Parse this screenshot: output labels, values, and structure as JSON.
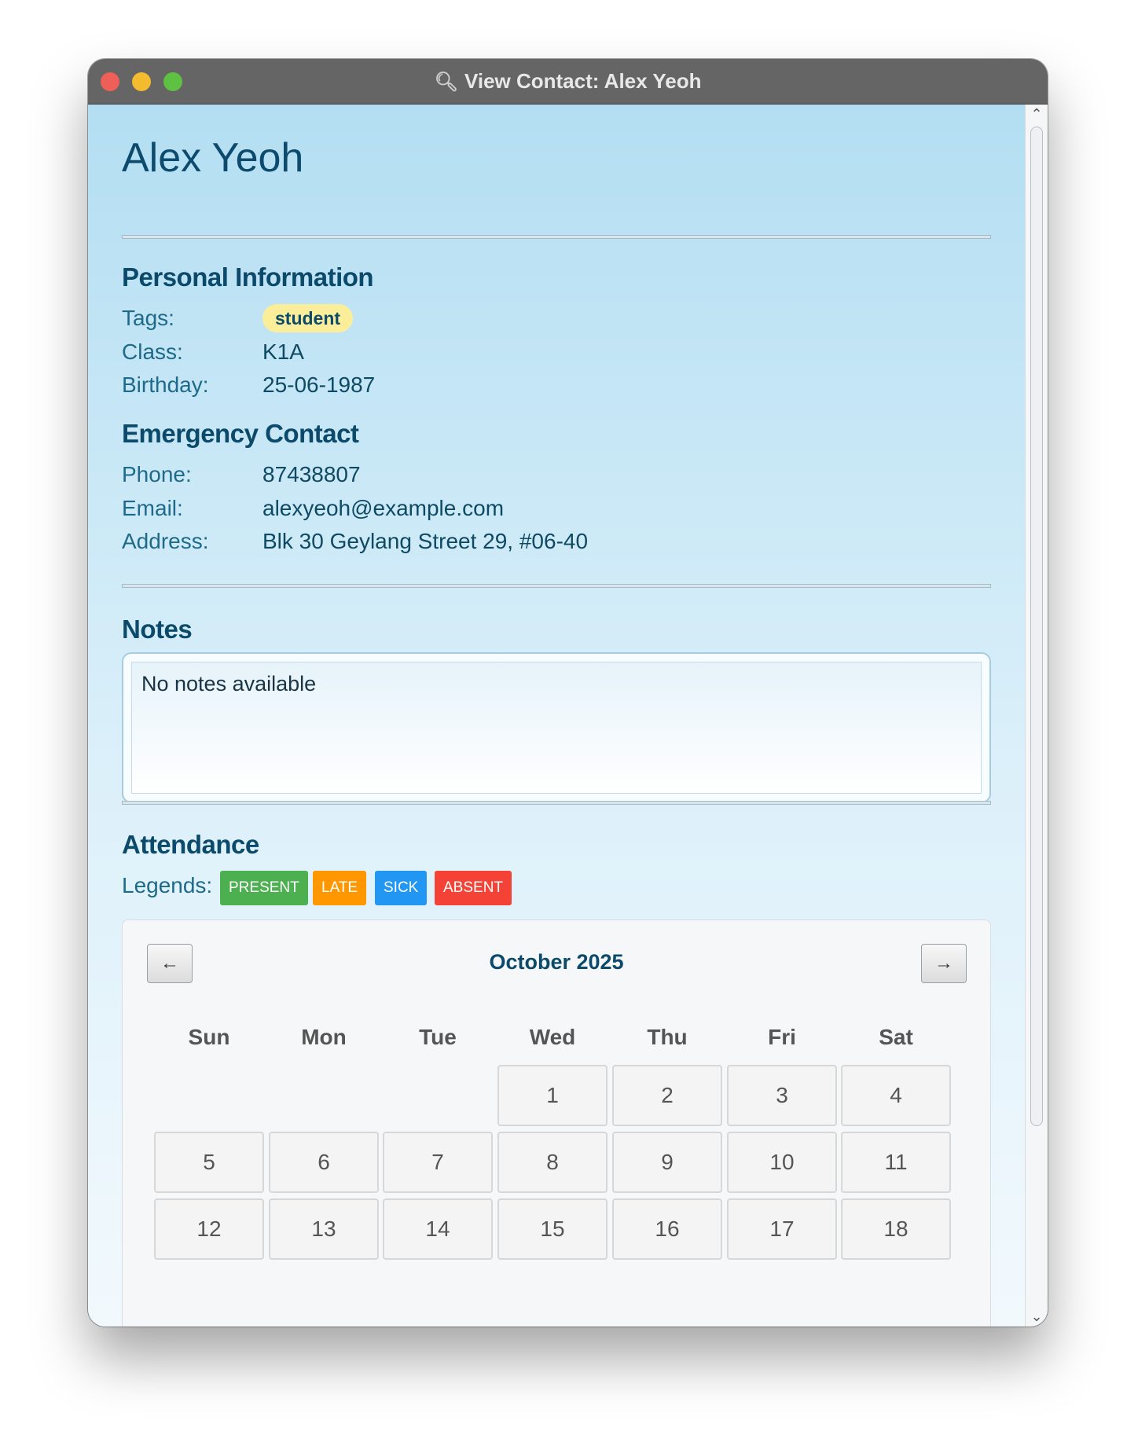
{
  "window": {
    "title": "View Contact: Alex Yeoh",
    "title_icon": "magnifier-icon"
  },
  "contact": {
    "name": "Alex Yeoh"
  },
  "personal": {
    "heading": "Personal Information",
    "tags_label": "Tags:",
    "tags": [
      "student"
    ],
    "class_label": "Class:",
    "class_value": "K1A",
    "birthday_label": "Birthday:",
    "birthday_value": "25-06-1987"
  },
  "emergency": {
    "heading": "Emergency Contact",
    "phone_label": "Phone:",
    "phone_value": "87438807",
    "email_label": "Email:",
    "email_value": "alexyeoh@example.com",
    "address_label": "Address:",
    "address_value": "Blk 30 Geylang Street 29, #06-40"
  },
  "notes": {
    "heading": "Notes",
    "text": "No notes available"
  },
  "attendance": {
    "heading": "Attendance",
    "legends_label": "Legends:",
    "legends": [
      {
        "label": "PRESENT",
        "color": "#4caf50"
      },
      {
        "label": "LATE",
        "color": "#ff9800"
      },
      {
        "label": "SICK",
        "color": "#2196f3"
      },
      {
        "label": "ABSENT",
        "color": "#f44336"
      }
    ],
    "calendar": {
      "month": "October 2025",
      "prev_icon": "arrow-left-icon",
      "next_icon": "arrow-right-icon",
      "weekdays": [
        "Sun",
        "Mon",
        "Tue",
        "Wed",
        "Thu",
        "Fri",
        "Sat"
      ],
      "weeks": [
        [
          "",
          "",
          "",
          "1",
          "2",
          "3",
          "4"
        ],
        [
          "5",
          "6",
          "7",
          "8",
          "9",
          "10",
          "11"
        ],
        [
          "12",
          "13",
          "14",
          "15",
          "16",
          "17",
          "18"
        ]
      ]
    }
  },
  "colors": {
    "accent": "#0b4a6a",
    "tag_background": "#fbee9b"
  }
}
